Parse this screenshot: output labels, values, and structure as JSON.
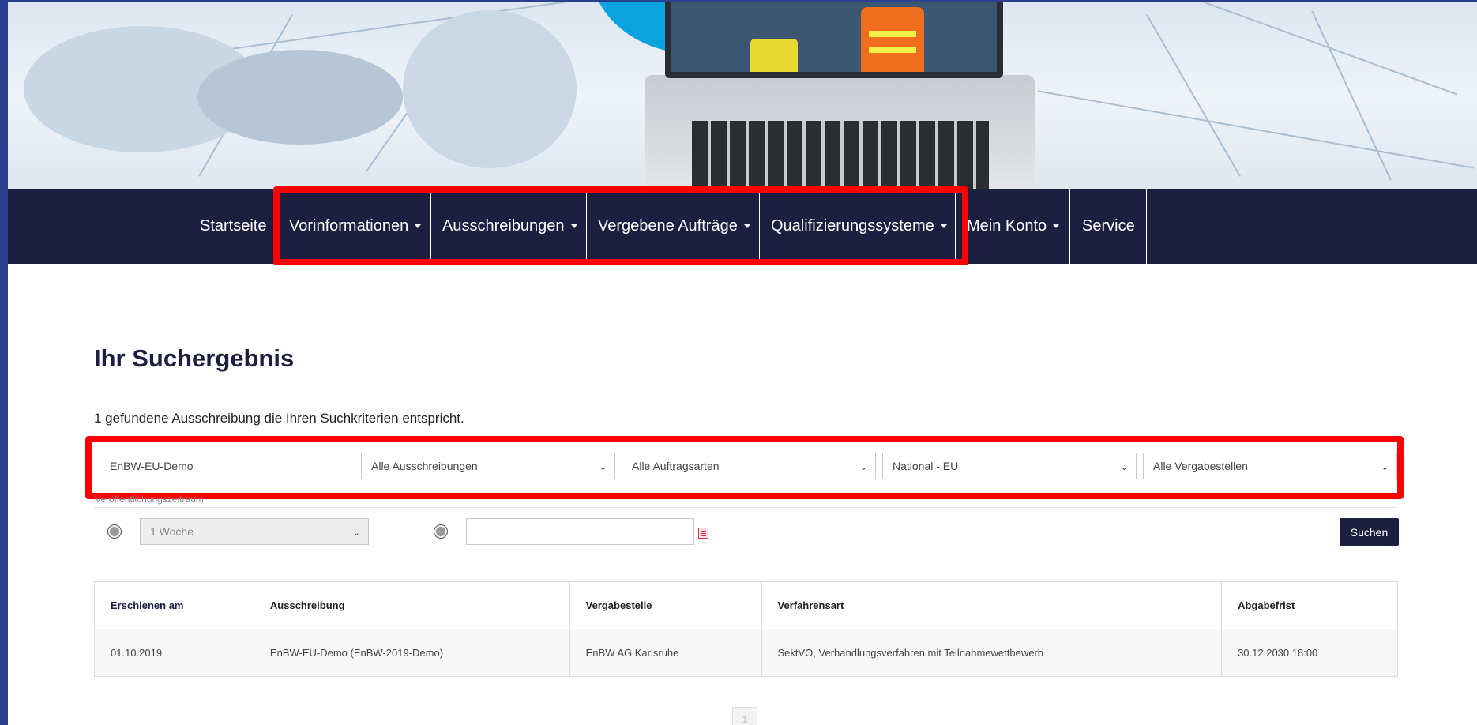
{
  "nav": {
    "items": [
      {
        "label": "Startseite",
        "caret": false
      },
      {
        "label": "Vorinformationen",
        "caret": true
      },
      {
        "label": "Ausschreibungen",
        "caret": true
      },
      {
        "label": "Vergebene Aufträge",
        "caret": true
      },
      {
        "label": "Qualifizierungssysteme",
        "caret": true
      },
      {
        "label": "Mein Konto",
        "caret": true
      },
      {
        "label": "Service",
        "caret": false
      }
    ]
  },
  "main": {
    "heading": "Ihr Suchergebnis",
    "result_count_text": "1 gefundene Ausschreibung die Ihren Suchkriterien entspricht."
  },
  "filters": {
    "search_value": "EnBW-EU-Demo",
    "ausschreibungen_selected": "Alle Ausschreibungen",
    "auftragsarten_selected": "Alle Auftragsarten",
    "region_selected": "National - EU",
    "vergabestellen_selected": "Alle Vergabestellen",
    "period_label": "Veröffentlichungszeitraum:",
    "period_selected": "1 Woche",
    "date_value": "",
    "search_button": "Suchen"
  },
  "table": {
    "headers": [
      "Erschienen am",
      "Ausschreibung",
      "Vergabestelle",
      "Verfahrensart",
      "Abgabefrist"
    ],
    "rows": [
      [
        "01.10.2019",
        "EnBW-EU-Demo (EnBW-2019-Demo)",
        "EnBW AG Karlsruhe",
        "SektVO, Verhandlungsverfahren mit Teilnahmewettbewerb",
        "30.12.2030 18:00"
      ]
    ]
  },
  "pagination": {
    "current_page": "1"
  },
  "colors": {
    "nav_bg": "#1c1f3f",
    "highlight": "#ff0000",
    "button_bg": "#1c1f3f",
    "frame": "#2c3f8f"
  }
}
